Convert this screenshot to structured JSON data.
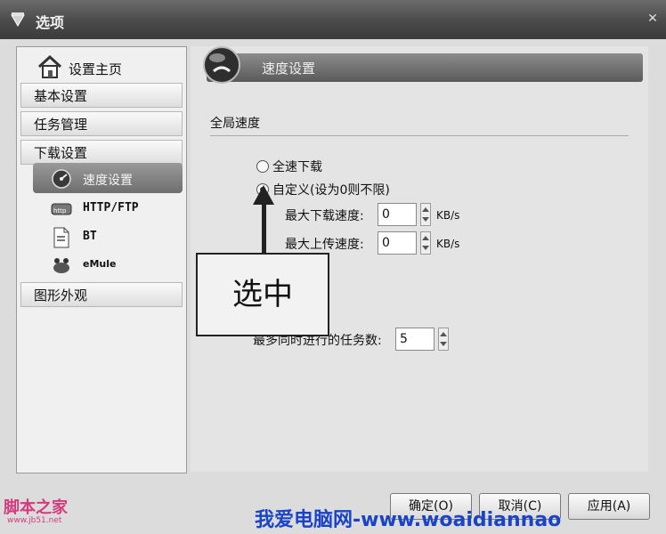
{
  "window": {
    "title": "选项"
  },
  "sidebar": {
    "home_label": "设置主页",
    "items": [
      {
        "label": "基本设置"
      },
      {
        "label": "任务管理"
      },
      {
        "label": "下载设置"
      }
    ],
    "sub_items": [
      {
        "label": "速度设置",
        "icon": "speed-icon"
      },
      {
        "label": "HTTP/FTP",
        "icon": "http-icon"
      },
      {
        "label": "BT",
        "icon": "bt-icon"
      },
      {
        "label": "eMule",
        "icon": "emule-icon"
      }
    ],
    "last_item": {
      "label": "图形外观"
    }
  },
  "content": {
    "header_title": "速度设置",
    "group_label": "全局速度",
    "option_full": "全速下载",
    "option_custom": "自定义(设为0则不限)",
    "max_download_label": "最大下载速度:",
    "max_download_value": "0",
    "max_upload_label": "最大上传速度:",
    "max_upload_value": "0",
    "unit": "KB/s",
    "max_tasks_label": "最多同时进行的任务数:",
    "max_tasks_value": "5"
  },
  "annotation": {
    "callout_text": "选中"
  },
  "buttons": {
    "ok": "确定(O)",
    "cancel": "取消(C)",
    "apply": "应用(A)"
  },
  "watermarks": {
    "left": "脚本之家",
    "left_sub": "www.jb51.net",
    "bottom": "我爱电脑网-www.woaidiannao"
  }
}
